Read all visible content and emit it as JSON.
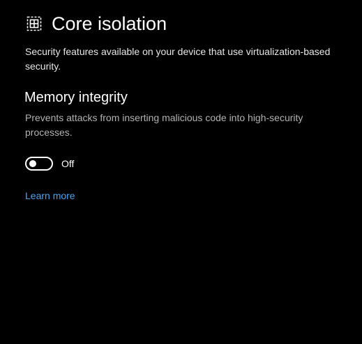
{
  "header": {
    "title": "Core isolation",
    "icon": "core-isolation-icon"
  },
  "description": "Security features available on your device that use virtualization-based security.",
  "memory_integrity": {
    "heading": "Memory integrity",
    "description": "Prevents attacks from inserting malicious code into high-security processes.",
    "toggle": {
      "state": false,
      "label": "Off"
    }
  },
  "links": {
    "learn_more": "Learn more"
  },
  "colors": {
    "background": "#000000",
    "text": "#ffffff",
    "secondary_text": "#b3b3b3",
    "link": "#4ea3f1"
  }
}
